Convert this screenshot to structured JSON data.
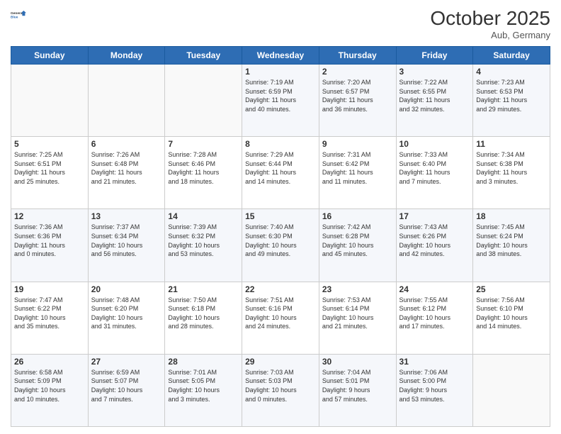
{
  "header": {
    "logo_line1": "General",
    "logo_line2": "Blue",
    "month_title": "October 2025",
    "location": "Aub, Germany"
  },
  "days_of_week": [
    "Sunday",
    "Monday",
    "Tuesday",
    "Wednesday",
    "Thursday",
    "Friday",
    "Saturday"
  ],
  "weeks": [
    [
      {
        "day": "",
        "info": ""
      },
      {
        "day": "",
        "info": ""
      },
      {
        "day": "",
        "info": ""
      },
      {
        "day": "1",
        "info": "Sunrise: 7:19 AM\nSunset: 6:59 PM\nDaylight: 11 hours\nand 40 minutes."
      },
      {
        "day": "2",
        "info": "Sunrise: 7:20 AM\nSunset: 6:57 PM\nDaylight: 11 hours\nand 36 minutes."
      },
      {
        "day": "3",
        "info": "Sunrise: 7:22 AM\nSunset: 6:55 PM\nDaylight: 11 hours\nand 32 minutes."
      },
      {
        "day": "4",
        "info": "Sunrise: 7:23 AM\nSunset: 6:53 PM\nDaylight: 11 hours\nand 29 minutes."
      }
    ],
    [
      {
        "day": "5",
        "info": "Sunrise: 7:25 AM\nSunset: 6:51 PM\nDaylight: 11 hours\nand 25 minutes."
      },
      {
        "day": "6",
        "info": "Sunrise: 7:26 AM\nSunset: 6:48 PM\nDaylight: 11 hours\nand 21 minutes."
      },
      {
        "day": "7",
        "info": "Sunrise: 7:28 AM\nSunset: 6:46 PM\nDaylight: 11 hours\nand 18 minutes."
      },
      {
        "day": "8",
        "info": "Sunrise: 7:29 AM\nSunset: 6:44 PM\nDaylight: 11 hours\nand 14 minutes."
      },
      {
        "day": "9",
        "info": "Sunrise: 7:31 AM\nSunset: 6:42 PM\nDaylight: 11 hours\nand 11 minutes."
      },
      {
        "day": "10",
        "info": "Sunrise: 7:33 AM\nSunset: 6:40 PM\nDaylight: 11 hours\nand 7 minutes."
      },
      {
        "day": "11",
        "info": "Sunrise: 7:34 AM\nSunset: 6:38 PM\nDaylight: 11 hours\nand 3 minutes."
      }
    ],
    [
      {
        "day": "12",
        "info": "Sunrise: 7:36 AM\nSunset: 6:36 PM\nDaylight: 11 hours\nand 0 minutes."
      },
      {
        "day": "13",
        "info": "Sunrise: 7:37 AM\nSunset: 6:34 PM\nDaylight: 10 hours\nand 56 minutes."
      },
      {
        "day": "14",
        "info": "Sunrise: 7:39 AM\nSunset: 6:32 PM\nDaylight: 10 hours\nand 53 minutes."
      },
      {
        "day": "15",
        "info": "Sunrise: 7:40 AM\nSunset: 6:30 PM\nDaylight: 10 hours\nand 49 minutes."
      },
      {
        "day": "16",
        "info": "Sunrise: 7:42 AM\nSunset: 6:28 PM\nDaylight: 10 hours\nand 45 minutes."
      },
      {
        "day": "17",
        "info": "Sunrise: 7:43 AM\nSunset: 6:26 PM\nDaylight: 10 hours\nand 42 minutes."
      },
      {
        "day": "18",
        "info": "Sunrise: 7:45 AM\nSunset: 6:24 PM\nDaylight: 10 hours\nand 38 minutes."
      }
    ],
    [
      {
        "day": "19",
        "info": "Sunrise: 7:47 AM\nSunset: 6:22 PM\nDaylight: 10 hours\nand 35 minutes."
      },
      {
        "day": "20",
        "info": "Sunrise: 7:48 AM\nSunset: 6:20 PM\nDaylight: 10 hours\nand 31 minutes."
      },
      {
        "day": "21",
        "info": "Sunrise: 7:50 AM\nSunset: 6:18 PM\nDaylight: 10 hours\nand 28 minutes."
      },
      {
        "day": "22",
        "info": "Sunrise: 7:51 AM\nSunset: 6:16 PM\nDaylight: 10 hours\nand 24 minutes."
      },
      {
        "day": "23",
        "info": "Sunrise: 7:53 AM\nSunset: 6:14 PM\nDaylight: 10 hours\nand 21 minutes."
      },
      {
        "day": "24",
        "info": "Sunrise: 7:55 AM\nSunset: 6:12 PM\nDaylight: 10 hours\nand 17 minutes."
      },
      {
        "day": "25",
        "info": "Sunrise: 7:56 AM\nSunset: 6:10 PM\nDaylight: 10 hours\nand 14 minutes."
      }
    ],
    [
      {
        "day": "26",
        "info": "Sunrise: 6:58 AM\nSunset: 5:09 PM\nDaylight: 10 hours\nand 10 minutes."
      },
      {
        "day": "27",
        "info": "Sunrise: 6:59 AM\nSunset: 5:07 PM\nDaylight: 10 hours\nand 7 minutes."
      },
      {
        "day": "28",
        "info": "Sunrise: 7:01 AM\nSunset: 5:05 PM\nDaylight: 10 hours\nand 3 minutes."
      },
      {
        "day": "29",
        "info": "Sunrise: 7:03 AM\nSunset: 5:03 PM\nDaylight: 10 hours\nand 0 minutes."
      },
      {
        "day": "30",
        "info": "Sunrise: 7:04 AM\nSunset: 5:01 PM\nDaylight: 9 hours\nand 57 minutes."
      },
      {
        "day": "31",
        "info": "Sunrise: 7:06 AM\nSunset: 5:00 PM\nDaylight: 9 hours\nand 53 minutes."
      },
      {
        "day": "",
        "info": ""
      }
    ]
  ]
}
